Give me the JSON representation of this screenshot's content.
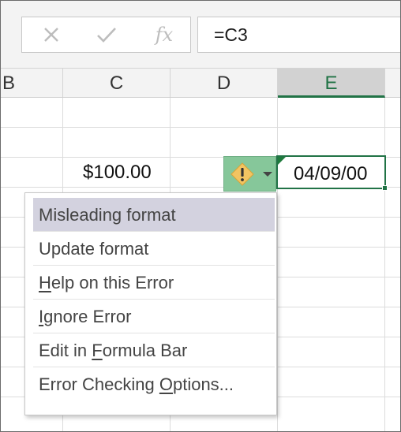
{
  "formula_bar": {
    "cancel_icon": "x-icon",
    "enter_icon": "checkmark-icon",
    "function_label": "fx",
    "formula": "=C3"
  },
  "columns": [
    "B",
    "C",
    "D",
    "E"
  ],
  "active_column": "E",
  "cells": {
    "C3": "$100.00",
    "E3": "04/09/00"
  },
  "smart_tag": {
    "icon": "warning-diamond-icon",
    "dropdown_icon": "caret-down-icon"
  },
  "error_menu": {
    "items": [
      {
        "pre": "Misleading format",
        "key": "",
        "post": ""
      },
      {
        "pre": "Update format",
        "key": "",
        "post": ""
      },
      {
        "pre": "",
        "key": "H",
        "post": "elp on this Error"
      },
      {
        "pre": "",
        "key": "I",
        "post": "gnore Error"
      },
      {
        "pre": "Edit in ",
        "key": "F",
        "post": "ormula Bar"
      },
      {
        "pre": "Error Checking ",
        "key": "O",
        "post": "ptions..."
      }
    ]
  },
  "colors": {
    "accent": "#217346",
    "smart_tag": "#86c79a",
    "menu_highlight": "#d3d2df"
  }
}
